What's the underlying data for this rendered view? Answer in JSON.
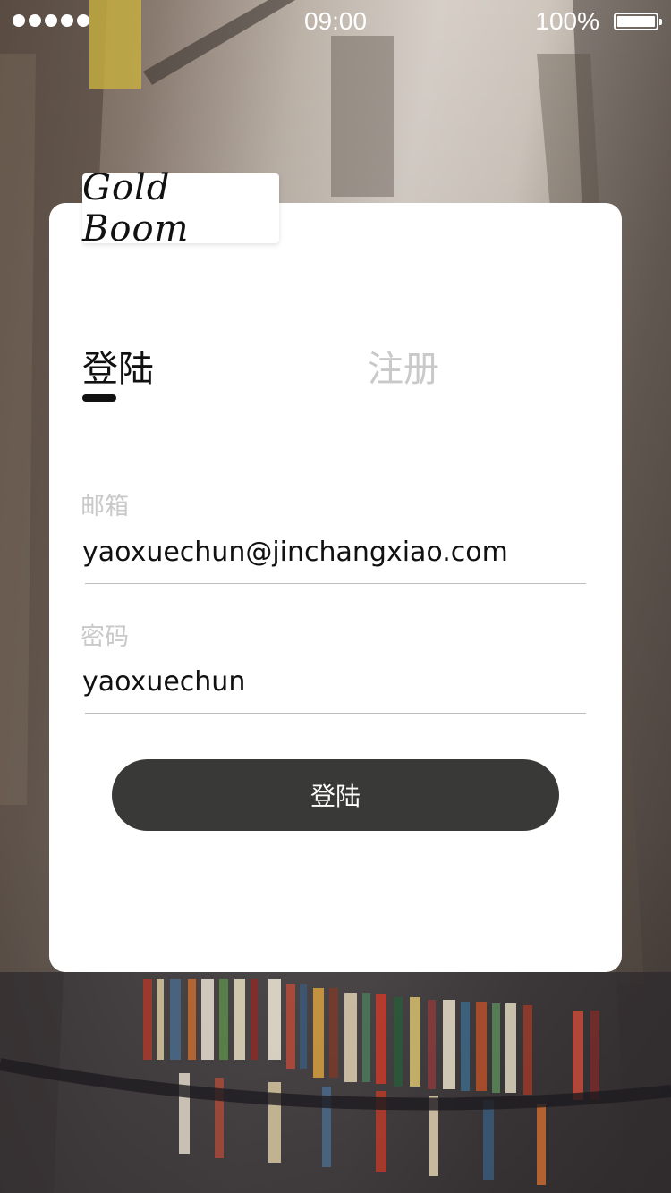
{
  "status_bar": {
    "time": "09:00",
    "battery_percent": "100%",
    "signal_bars": 5,
    "battery_level": 1.0
  },
  "logo": {
    "text": "Gold  Boom"
  },
  "tabs": [
    {
      "label": "登陆",
      "active": true
    },
    {
      "label": "注册",
      "active": false
    }
  ],
  "form": {
    "email_label": "邮箱",
    "email_value": "yaoxuechun@jinchangxiao.com",
    "password_label": "密码",
    "password_value": "yaoxuechun"
  },
  "submit_label": "登陆",
  "colors": {
    "button_bg": "#393a38",
    "active_tab": "#111111",
    "inactive_tab": "#c9c9c9",
    "label": "#c9c9c9",
    "card_bg": "#ffffff"
  }
}
